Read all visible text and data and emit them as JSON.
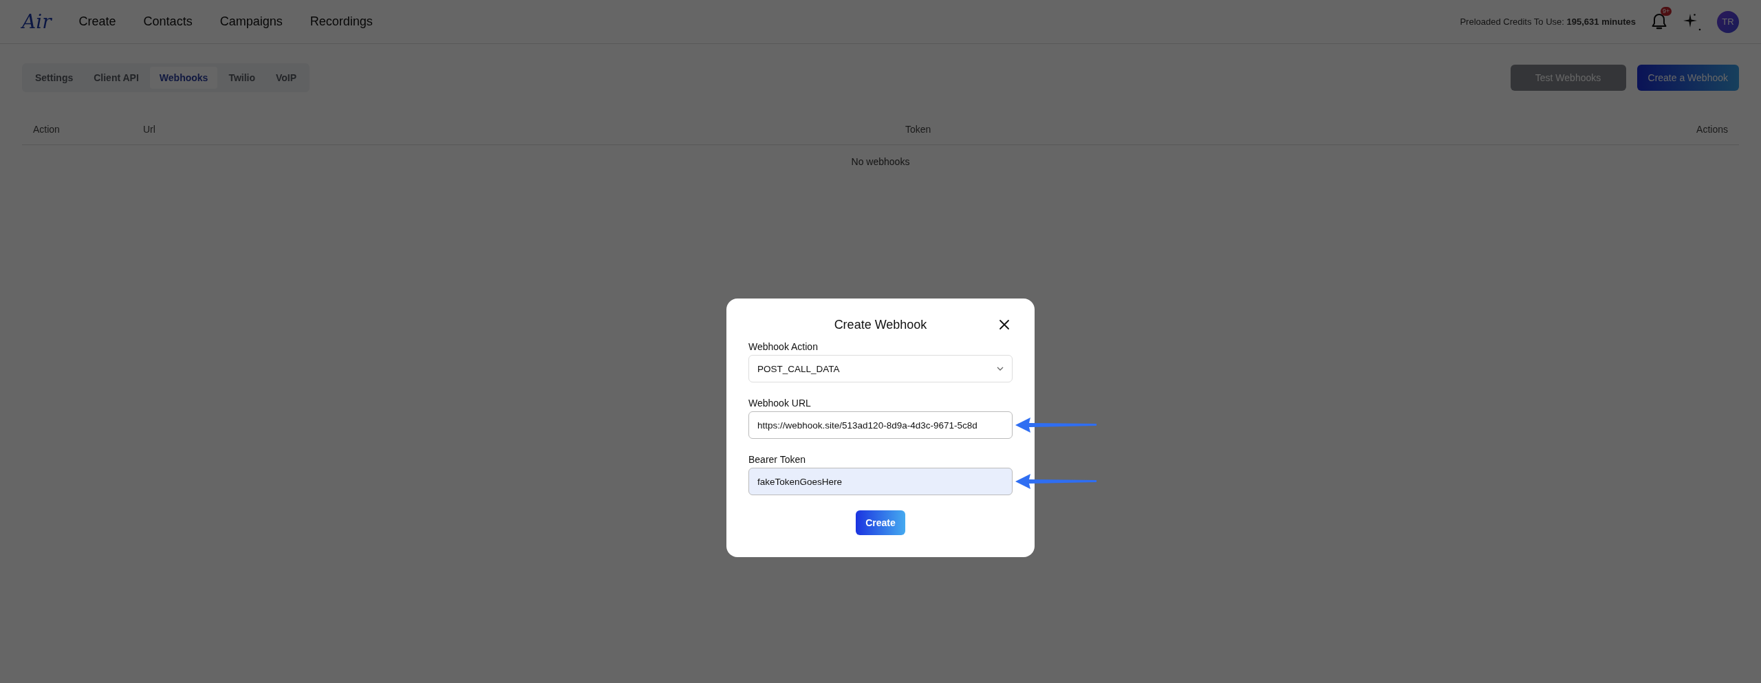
{
  "header": {
    "logo": "Air",
    "nav": [
      {
        "label": "Create"
      },
      {
        "label": "Contacts"
      },
      {
        "label": "Campaigns"
      },
      {
        "label": "Recordings"
      }
    ],
    "credits": "Preloaded Credits To Use: **195,631 minutes**",
    "notification_badge": "9+",
    "avatar": "TR"
  },
  "tabs": [
    {
      "label": "Settings",
      "selected": false
    },
    {
      "label": "Client API",
      "selected": false
    },
    {
      "label": "Webhooks",
      "selected": true
    },
    {
      "label": "Twilio",
      "selected": false
    },
    {
      "label": "VoIP",
      "selected": false
    }
  ],
  "buttons": [
    {
      "label": "Test Webhooks",
      "disabled": true
    },
    {
      "label": "Create a Webhook",
      "disabled": false
    }
  ],
  "table": {
    "columns": [
      "Action",
      "Url",
      "Token",
      "Actions"
    ],
    "empty_message": "No webhooks"
  },
  "modal": {
    "title": "Create Webhook",
    "fields": [
      {
        "kind": "select",
        "label": "Webhook Action",
        "value": "POST_CALL_DATA",
        "highlighted": false,
        "pointer_arrow": false
      },
      {
        "kind": "text",
        "label": "Webhook URL",
        "value": "https://webhook.site/513ad120-8d9a-4d3c-9671-5c8d",
        "highlighted": false,
        "pointer_arrow": true
      },
      {
        "kind": "text",
        "label": "Bearer Token",
        "value": "fakeTokenGoesHere",
        "highlighted": true,
        "pointer_arrow": true
      }
    ],
    "submit": "Create"
  }
}
